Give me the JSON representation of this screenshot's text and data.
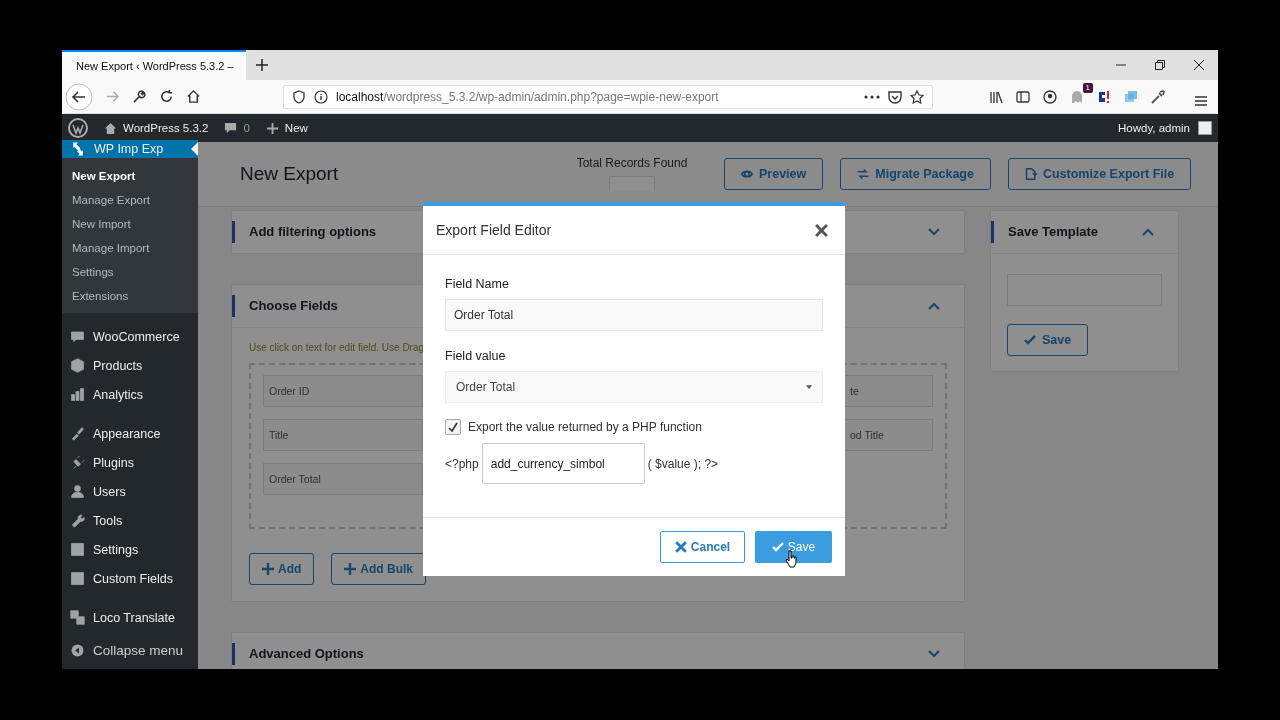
{
  "browser": {
    "tab_title": "New Export ‹ WordPress 5.3.2 –",
    "url_host": "localhost",
    "url_path": "/wordpress_5.3.2/wp-admin/admin.php?page=wpie-new-export",
    "extension_badge": "1"
  },
  "admin_bar": {
    "site": "WordPress 5.3.2",
    "comments": "0",
    "new": "New",
    "howdy": "Howdy, admin"
  },
  "sidebar": {
    "active_menu": "WP Imp Exp",
    "submenu": [
      {
        "label": "New Export",
        "selected": true
      },
      {
        "label": "Manage Export",
        "selected": false
      },
      {
        "label": "New Import",
        "selected": false
      },
      {
        "label": "Manage Import",
        "selected": false
      },
      {
        "label": "Settings",
        "selected": false
      },
      {
        "label": "Extensions",
        "selected": false
      }
    ],
    "menu": [
      {
        "label": "WooCommerce",
        "kind": "woo"
      },
      {
        "label": "Products",
        "kind": "box"
      },
      {
        "label": "Analytics",
        "kind": "bars"
      },
      {
        "label": "Appearance",
        "kind": "brush"
      },
      {
        "label": "Plugins",
        "kind": "plug"
      },
      {
        "label": "Users",
        "kind": "user"
      },
      {
        "label": "Tools",
        "kind": "wrench"
      },
      {
        "label": "Settings",
        "kind": "sliders"
      },
      {
        "label": "Custom Fields",
        "kind": "table"
      },
      {
        "label": "Loco Translate",
        "kind": "translate"
      }
    ],
    "collapse": "Collapse menu"
  },
  "page": {
    "title": "New Export",
    "total_records_label": "Total Records Found",
    "header_buttons": [
      {
        "label": "Preview",
        "kind": "eye"
      },
      {
        "label": "Migrate Package",
        "kind": "swap"
      },
      {
        "label": "Customize Export File",
        "kind": "file"
      }
    ],
    "filter_title": "Add filtering options",
    "choose_fields": {
      "title": "Choose Fields",
      "hint": "Use click on text for edit field. Use Drag",
      "left_fields": [
        "Order ID",
        "Title",
        "Order Total"
      ],
      "right_fields": [
        "te",
        "od Title"
      ],
      "buttons": [
        "Add",
        "Add Bulk"
      ]
    },
    "save_template": {
      "title": "Save Template",
      "button": "Save"
    },
    "advanced_title": "Advanced Options"
  },
  "modal": {
    "title": "Export Field Editor",
    "field_name_label": "Field Name",
    "field_name_value": "Order Total",
    "field_value_label": "Field value",
    "field_value_selected": "Order Total",
    "php_checkbox": {
      "label": "Export the value returned by a PHP function",
      "checked": true
    },
    "php_prefix": "<?php",
    "php_function": "add_currency_simbol",
    "php_suffix": "( $value ); ?>",
    "cancel": "Cancel",
    "save": "Save"
  }
}
